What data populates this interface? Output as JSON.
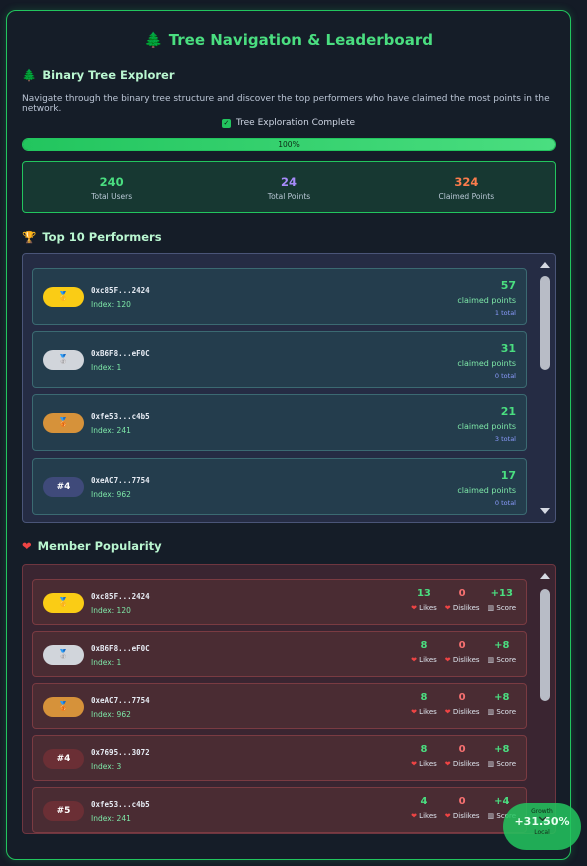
{
  "header": {
    "title": "Tree Navigation & Leaderboard",
    "icon": "tree-icon"
  },
  "explorer": {
    "heading": "Binary Tree Explorer",
    "description": "Navigate through the binary tree structure and discover the top performers who have claimed the most points in the network.",
    "checkbox_label": "Tree Exploration Complete",
    "progress_percent": 100,
    "progress_label": "100%",
    "stats": [
      {
        "value": "240",
        "label": "Total Users",
        "color": "#4ade80"
      },
      {
        "value": "24",
        "label": "Total Points",
        "color": "#a78bfa"
      },
      {
        "value": "324",
        "label": "Claimed Points",
        "color": "#fb7c4c"
      }
    ]
  },
  "top_performers": {
    "heading": "Top 10 Performers",
    "items": [
      {
        "badge": "🥇",
        "badge_color": "#facc15",
        "address": "0xc85F...2424",
        "index": "Index: 120",
        "points": "57",
        "claimed_label": "claimed points",
        "total": "1 total"
      },
      {
        "badge": "🥈",
        "badge_color": "#d1d5db",
        "address": "0xB6F8...eF0C",
        "index": "Index: 1",
        "points": "31",
        "claimed_label": "claimed points",
        "total": "0 total"
      },
      {
        "badge": "🥉",
        "badge_color": "#d6923a",
        "address": "0xfe53...c4b5",
        "index": "Index: 241",
        "points": "21",
        "claimed_label": "claimed points",
        "total": "3 total"
      },
      {
        "badge": "#4",
        "badge_color": "#3f4a7a",
        "address": "0xeAC7...7754",
        "index": "Index: 962",
        "points": "17",
        "claimed_label": "claimed points",
        "total": "0 total"
      }
    ]
  },
  "popularity": {
    "heading": "Member Popularity",
    "likes_label": "Likes",
    "dislikes_label": "Dislikes",
    "score_label": "Score",
    "items": [
      {
        "badge": "🥇",
        "badge_color": "#facc15",
        "address": "0xc85F...2424",
        "index": "Index: 120",
        "likes": "13",
        "dislikes": "0",
        "score": "+13"
      },
      {
        "badge": "🥈",
        "badge_color": "#d1d5db",
        "address": "0xB6F8...eF0C",
        "index": "Index: 1",
        "likes": "8",
        "dislikes": "0",
        "score": "+8"
      },
      {
        "badge": "🥉",
        "badge_color": "#d6923a",
        "address": "0xeAC7...7754",
        "index": "Index: 962",
        "likes": "8",
        "dislikes": "0",
        "score": "+8"
      },
      {
        "badge": "#4",
        "badge_color": "#6b2f35",
        "address": "0x7695...3072",
        "index": "Index: 3",
        "likes": "8",
        "dislikes": "0",
        "score": "+8"
      },
      {
        "badge": "#5",
        "badge_color": "#6b2f35",
        "address": "0xfe53...c4b5",
        "index": "Index: 241",
        "likes": "4",
        "dislikes": "0",
        "score": "+4"
      }
    ]
  },
  "fab": {
    "top": "Growth",
    "value": "+31.50%",
    "bottom": "Local"
  }
}
